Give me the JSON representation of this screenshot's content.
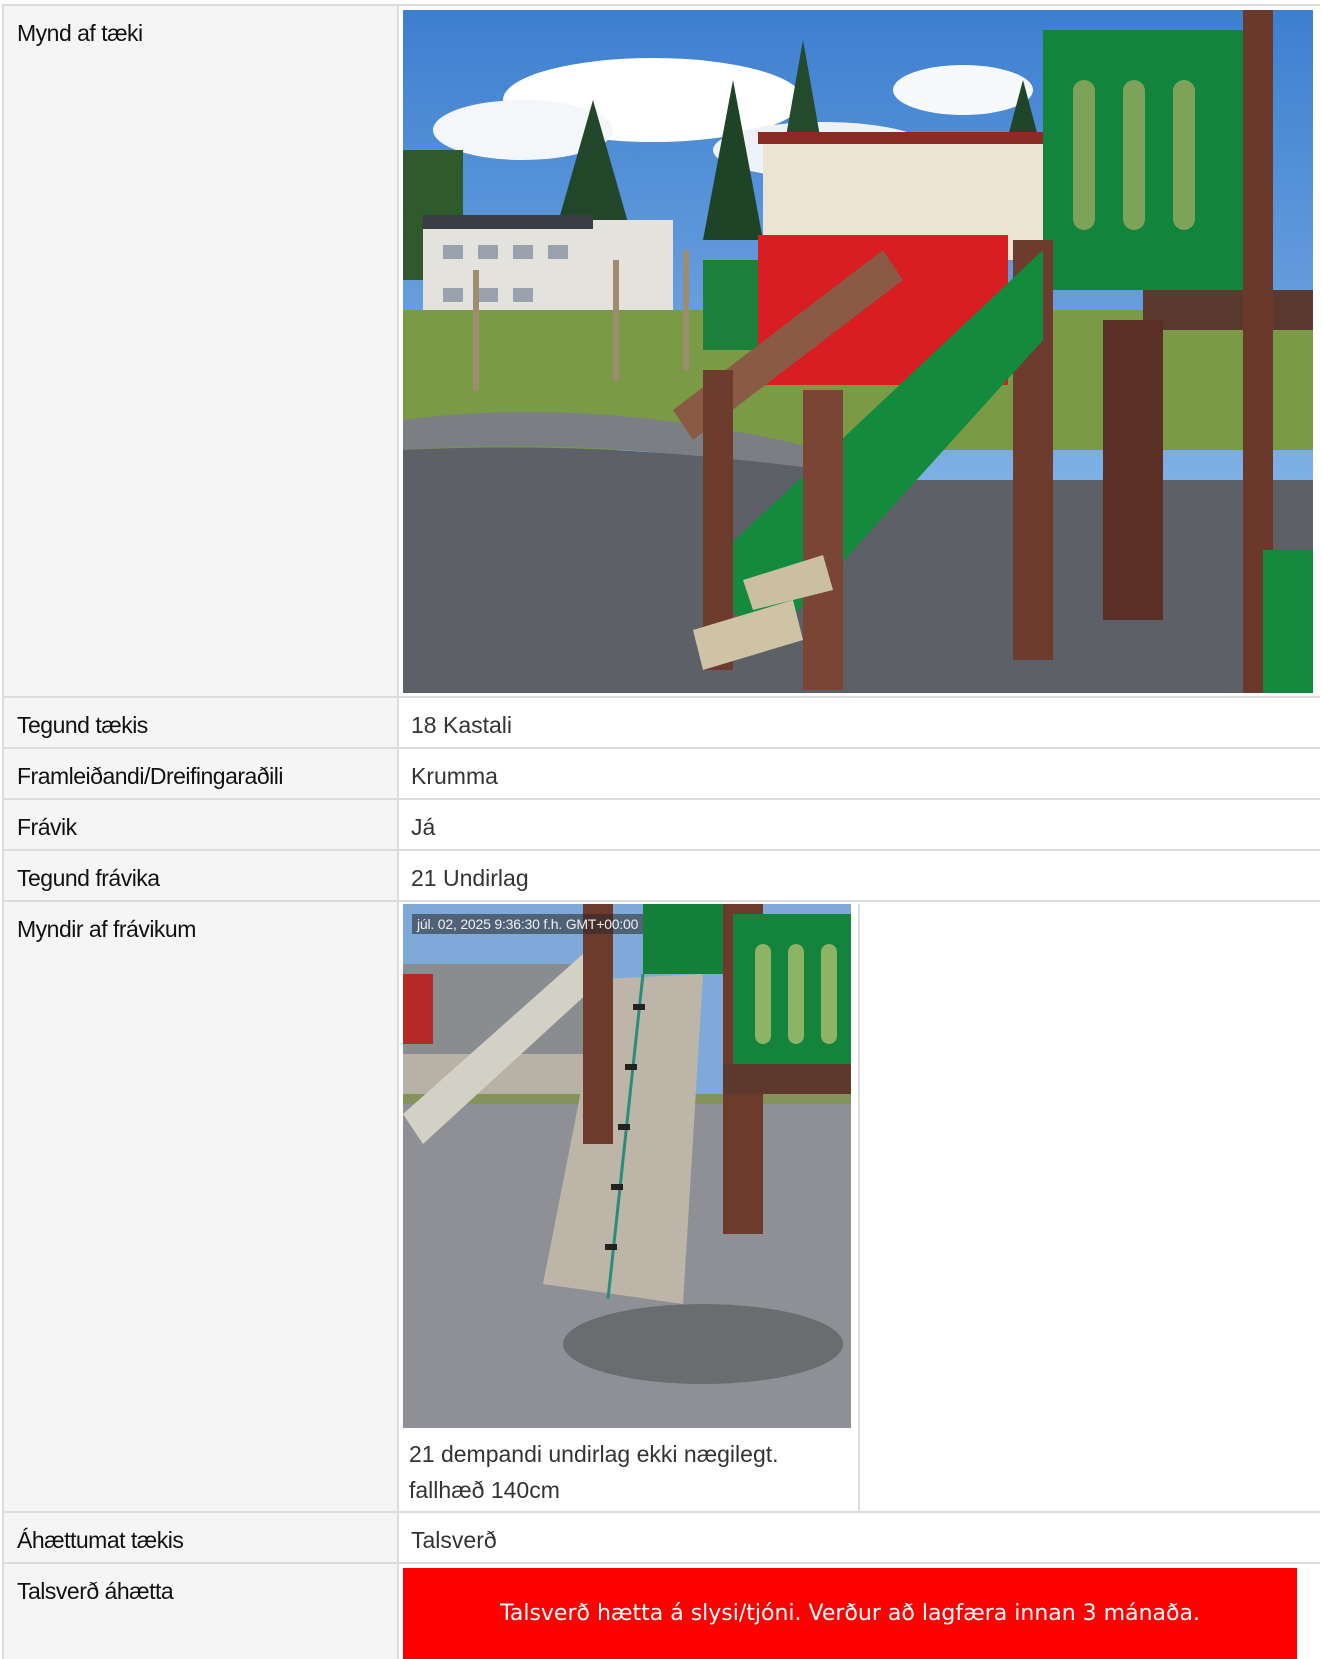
{
  "rows": {
    "photo": {
      "label": "Mynd af tæki"
    },
    "type": {
      "label": "Tegund tækis",
      "value": "18 Kastali"
    },
    "manufacturer": {
      "label": "Framleiðandi/Dreifingaraðili",
      "value": "Krumma"
    },
    "deviation": {
      "label": "Frávik",
      "value": "Já"
    },
    "deviation_type": {
      "label": "Tegund frávika",
      "value": "21 Undirlag"
    },
    "deviation_photos": {
      "label": "Myndir af frávikum",
      "timestamp": "júl. 02, 2025 9:36:30 f.h. GMT+00:00",
      "caption_line1": "21 dempandi undirlag ekki nægilegt.",
      "caption_line2": "fallhæð 140cm"
    },
    "risk": {
      "label": "Áhættumat tækis",
      "value": "Talsverð"
    },
    "risk_text": {
      "label": "Talsverð áhætta",
      "value": "Talsverð hætta á slysi/tjóni. Verður að lagfæra innan 3 mánaða."
    }
  },
  "colors": {
    "warning": "#ff0000",
    "label_bg": "#f5f5f5",
    "border": "#dcdcdc"
  }
}
